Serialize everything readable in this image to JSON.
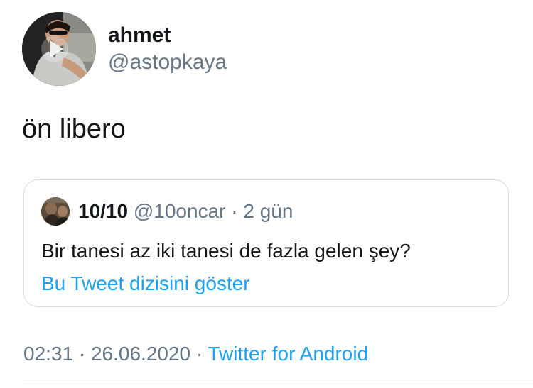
{
  "author": {
    "name": "ahmet",
    "handle": "@astopkaya",
    "avatar_icon": "profile-photo-with-play-icon"
  },
  "tweet": {
    "text": "ön libero"
  },
  "quoted_tweet": {
    "name": "10/10",
    "handle": "@10oncar",
    "separator": "·",
    "time": "2 gün",
    "text": "Bir tanesi az iki tanesi de fazla gelen şey?",
    "thread_link": "Bu Tweet dizisini göster"
  },
  "meta": {
    "time": "02:31",
    "separator1": "·",
    "date": "26.06.2020",
    "separator2": "·",
    "source": "Twitter for Android"
  },
  "colors": {
    "text": "#14171a",
    "secondary": "#657786",
    "link": "#1da1f2",
    "border": "#d6dde3"
  }
}
